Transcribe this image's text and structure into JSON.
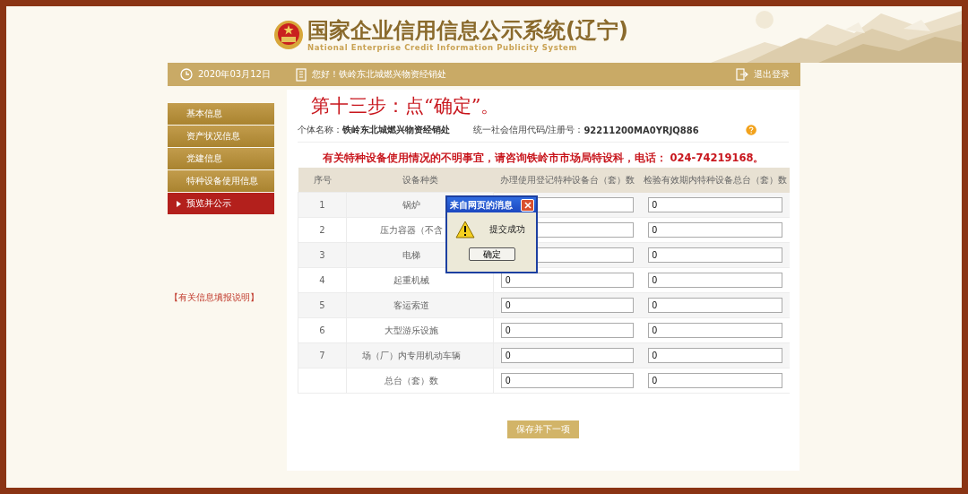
{
  "header": {
    "title": "国家企业信用信息公示系统(辽宁)",
    "subtitle": "National Enterprise Credit Information Publicity System"
  },
  "top_bar": {
    "date": "2020年03月12日",
    "greeting": "您好！铁岭东北城燃兴物资经销处",
    "logout": "退出登录"
  },
  "sidebar": {
    "items": [
      {
        "label": "基本信息",
        "selected": false
      },
      {
        "label": "资产状况信息",
        "selected": false
      },
      {
        "label": "党建信息",
        "selected": false
      },
      {
        "label": "特种设备使用信息",
        "selected": false
      },
      {
        "label": "预览并公示",
        "selected": true
      }
    ],
    "help_link": "【有关信息填报说明】"
  },
  "step_heading": "第十三步：点“确定”。",
  "info": {
    "name_label": "个体名称：",
    "name_value": "铁岭东北城燃兴物资经销处",
    "code_label": "统一社会信用代码/注册号：",
    "code_value": "92211200MA0YRJQ886"
  },
  "notice": "有关特种设备使用情况的不明事宜，请咨询铁岭市市场局特设科，电话： 024-74219168。",
  "table": {
    "columns": [
      "序号",
      "设备种类",
      "办理使用登记特种设备台（套）数",
      "检验有效期内特种设备总台（套）数"
    ],
    "rows": [
      {
        "no": "1",
        "category": "锅炉",
        "inspected": "0"
      },
      {
        "no": "2",
        "category": "压力容器（不含",
        "inspected": "0"
      },
      {
        "no": "3",
        "category": "电梯",
        "inspected": "0"
      },
      {
        "no": "4",
        "category": "起重机械",
        "registered": "0",
        "inspected": "0"
      },
      {
        "no": "5",
        "category": "客运索道",
        "registered": "0",
        "inspected": "0"
      },
      {
        "no": "6",
        "category": "大型游乐设施",
        "registered": "0",
        "inspected": "0"
      },
      {
        "no": "7",
        "category": "场（厂）内专用机动车辆",
        "registered": "0",
        "inspected": "0"
      },
      {
        "category": "总台（套）数",
        "registered": "0",
        "inspected": "0"
      }
    ]
  },
  "save_button": "保存并下一项",
  "dialog": {
    "title": "来自网页的消息",
    "message": "提交成功",
    "button": "确定"
  }
}
